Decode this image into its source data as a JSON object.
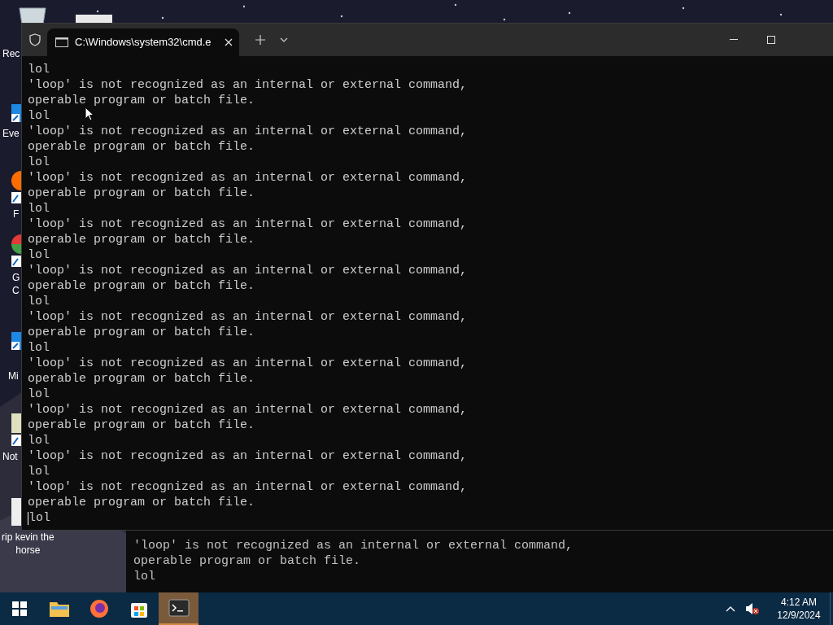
{
  "desktop_icons": [
    {
      "kind": "recycle",
      "label_lines": [
        "Rec"
      ]
    },
    {
      "kind": "edge",
      "label_lines": [
        "Eve"
      ]
    },
    {
      "kind": "firefox",
      "label_lines": [
        "F"
      ]
    },
    {
      "kind": "chrome",
      "label_lines": [
        "G",
        "C"
      ]
    },
    {
      "kind": "edge",
      "label_lines": [
        "Mi"
      ]
    },
    {
      "kind": "notepad",
      "label_lines": [
        "Not"
      ]
    },
    {
      "kind": "file",
      "label_lines": [
        "rip kevin the",
        "horse"
      ]
    }
  ],
  "terminal": {
    "tab_title": "C:\\Windows\\system32\\cmd.e",
    "cursor": true,
    "lines": [
      "lol",
      "'loop' is not recognized as an internal or external command,",
      "operable program or batch file.",
      "lol",
      "'loop' is not recognized as an internal or external command,",
      "operable program or batch file.",
      "lol",
      "'loop' is not recognized as an internal or external command,",
      "operable program or batch file.",
      "lol",
      "'loop' is not recognized as an internal or external command,",
      "operable program or batch file.",
      "lol",
      "'loop' is not recognized as an internal or external command,",
      "operable program or batch file.",
      "lol",
      "'loop' is not recognized as an internal or external command,",
      "operable program or batch file.",
      "lol",
      "'loop' is not recognized as an internal or external command,",
      "operable program or batch file.",
      "lol",
      "'loop' is not recognized as an internal or external command,",
      "operable program or batch file.",
      "lol",
      "'loop' is not recognized as an internal or external command,",
      "lol",
      "'loop' is not recognized as an internal or external command,",
      "operable program or batch file.",
      "lol"
    ]
  },
  "background_console": {
    "lines": [
      "'loop' is not recognized as an internal or external command,",
      "operable program or batch file.",
      "lol"
    ]
  },
  "taskbar": {
    "apps": [
      {
        "kind": "start",
        "selected": false
      },
      {
        "kind": "explorer",
        "selected": false
      },
      {
        "kind": "firefox",
        "selected": false
      },
      {
        "kind": "store",
        "selected": false
      },
      {
        "kind": "terminal",
        "selected": true
      }
    ],
    "time": "4:12 AM",
    "date": "12/9/2024"
  }
}
